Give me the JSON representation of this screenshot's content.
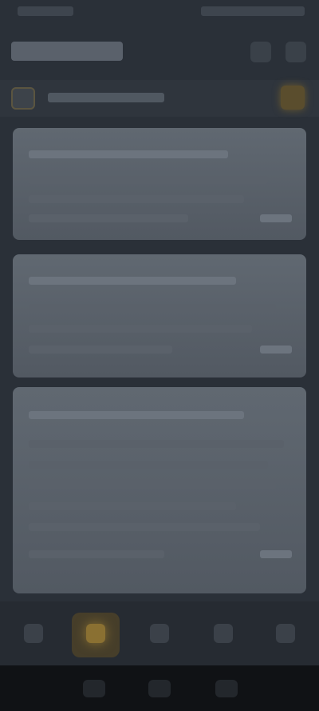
{
  "status_bar": {
    "time": "",
    "indicators": ""
  },
  "header": {
    "title": "",
    "actions": [
      {
        "icon": "search-icon"
      },
      {
        "icon": "more-icon"
      }
    ]
  },
  "filter_bar": {
    "left_icon": "menu-icon",
    "label": "",
    "right_icon": "filter-icon",
    "accent_color": "#8a7032"
  },
  "cards": [
    {
      "title": "",
      "lines": [
        "",
        "",
        ""
      ],
      "meta": ""
    },
    {
      "title": "",
      "lines": [
        "",
        "",
        ""
      ],
      "meta": ""
    },
    {
      "title": "",
      "lines": [
        "",
        "",
        "",
        "",
        "",
        ""
      ],
      "meta": ""
    }
  ],
  "bottom_nav": {
    "items": [
      {
        "icon": "home-icon",
        "label": "",
        "active": false
      },
      {
        "icon": "star-icon",
        "label": "",
        "active": true
      },
      {
        "icon": "grid-icon",
        "label": "",
        "active": false
      },
      {
        "icon": "chart-icon",
        "label": "",
        "active": false
      },
      {
        "icon": "profile-icon",
        "label": "",
        "active": false
      }
    ]
  },
  "system_nav": [
    "recents-icon",
    "home-icon",
    "back-icon"
  ]
}
